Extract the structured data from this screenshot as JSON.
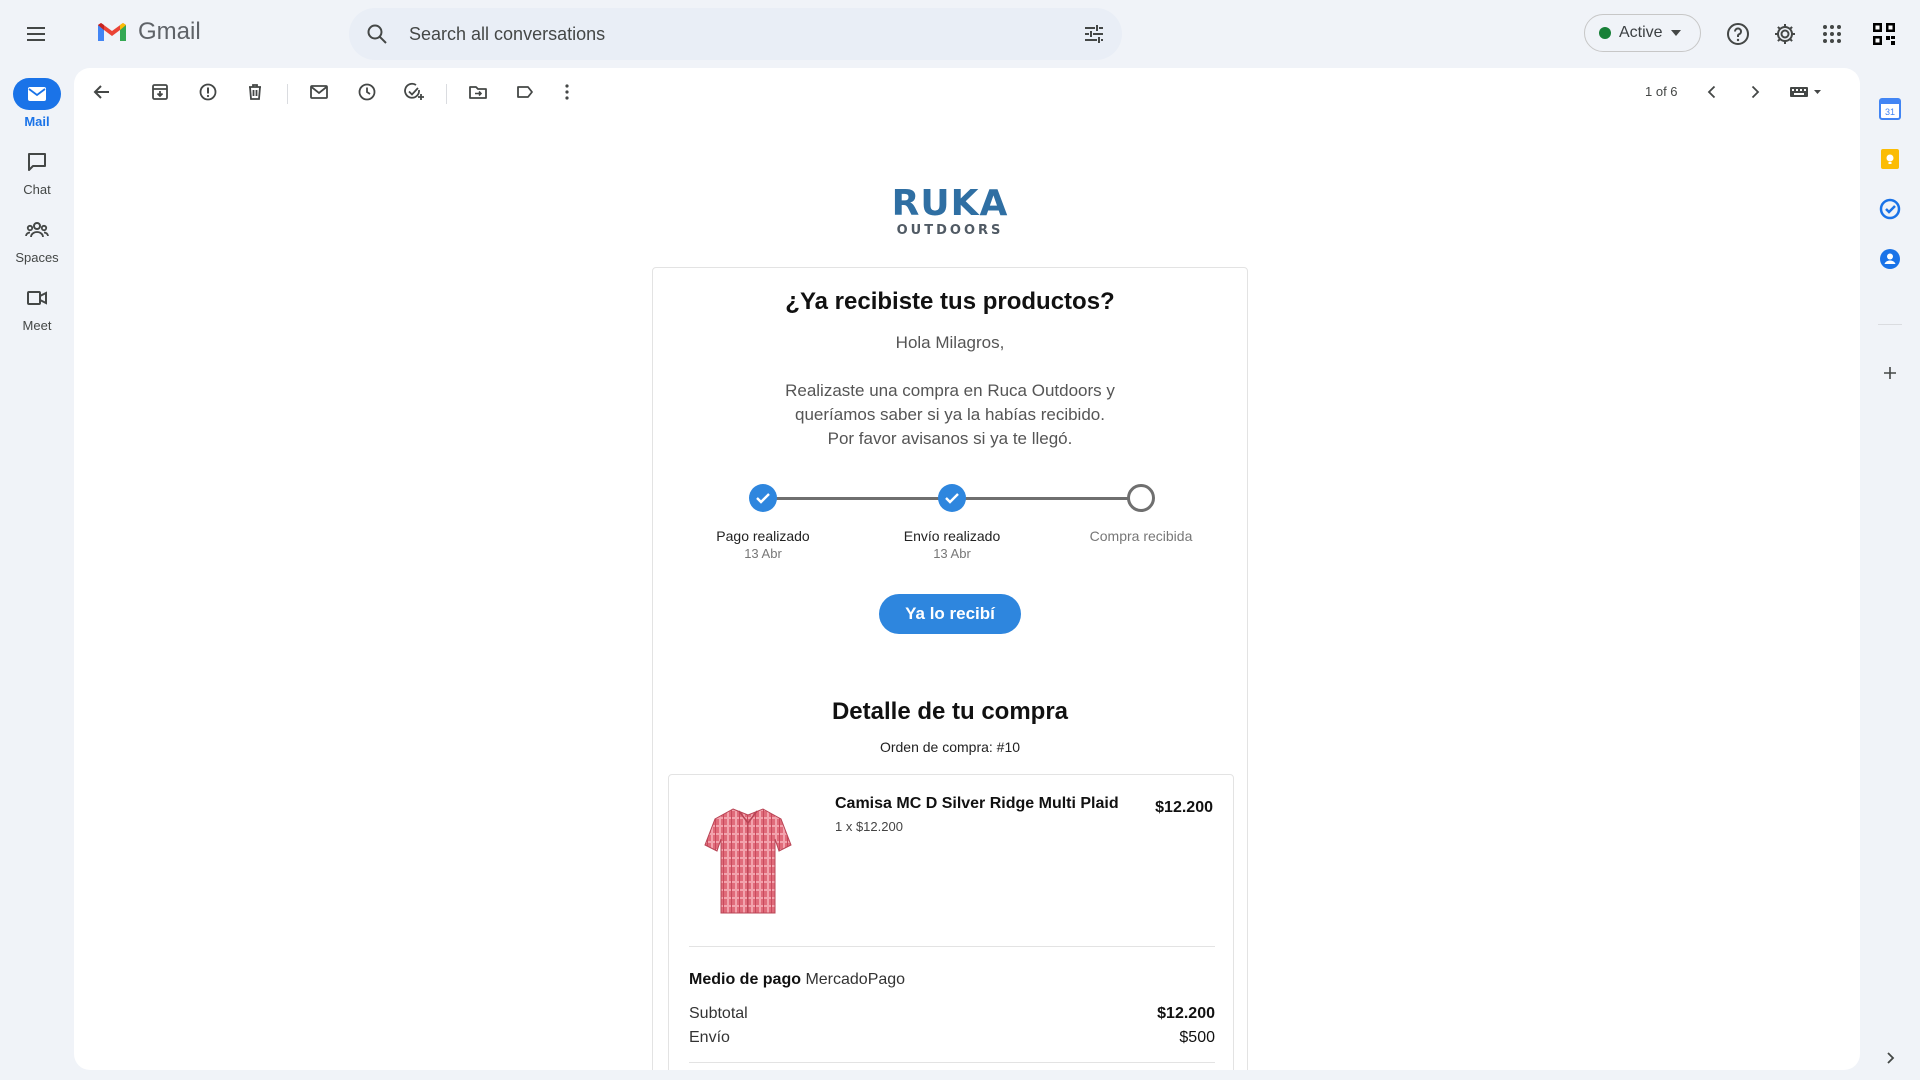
{
  "app": {
    "name": "Gmail"
  },
  "search": {
    "placeholder": "Search all conversations"
  },
  "status": {
    "label": "Active",
    "color": "#188038"
  },
  "icons": {
    "menu": "hamburger-menu-icon",
    "help": "help-icon",
    "settings": "gear-icon",
    "apps": "apps-grid-icon",
    "account": "account-icon"
  },
  "rail": [
    {
      "label": "Mail",
      "icon": "mail-icon",
      "active": true
    },
    {
      "label": "Chat",
      "icon": "chat-icon",
      "active": false
    },
    {
      "label": "Spaces",
      "icon": "spaces-icon",
      "active": false
    },
    {
      "label": "Meet",
      "icon": "video-icon",
      "active": false
    }
  ],
  "toolbar": {
    "page_count": "1 of 6",
    "icons": [
      "back-arrow-icon",
      "archive-icon",
      "report-spam-icon",
      "delete-icon",
      "mark-unread-icon",
      "snooze-icon",
      "add-task-icon",
      "move-to-icon",
      "label-icon",
      "more-vert-icon",
      "prev-icon",
      "next-icon",
      "keyboard-icon"
    ]
  },
  "email": {
    "brand": {
      "name": "RUKA",
      "sub": "OUTDOORS",
      "color": "#2f6fa3"
    },
    "title": "¿Ya recibiste tus productos?",
    "greeting": "Hola Milagros,",
    "message_lines": [
      "Realizaste una compra en Ruca Outdoors y",
      "queríamos saber si ya la habías recibido.",
      "Por favor avisanos si ya te llegó."
    ],
    "steps": [
      {
        "label": "Pago realizado",
        "date": "13 Abr",
        "done": true
      },
      {
        "label": "Envío realizado",
        "date": "13 Abr",
        "done": true
      },
      {
        "label": "Compra recibida",
        "date": "",
        "done": false
      }
    ],
    "cta": "Ya lo recibí",
    "accent_color": "#2e86de",
    "detail_title": "Detalle de tu compra",
    "order_number": "Orden de compra: #10",
    "product": {
      "name": "Camisa MC D Silver Ridge Multi Plaid",
      "qty": "1 x $12.200",
      "price": "$12.200",
      "image": "shirt-image"
    },
    "payment": {
      "label": "Medio de pago",
      "value": "MercadoPago"
    },
    "subtotal": {
      "label": "Subtotal",
      "value": "$12.200"
    },
    "shipping": {
      "label": "Envío",
      "value": "$500"
    }
  },
  "side_panel": [
    "calendar-icon",
    "keep-icon",
    "tasks-icon",
    "contacts-icon",
    "add-icon",
    "expand-icon"
  ]
}
